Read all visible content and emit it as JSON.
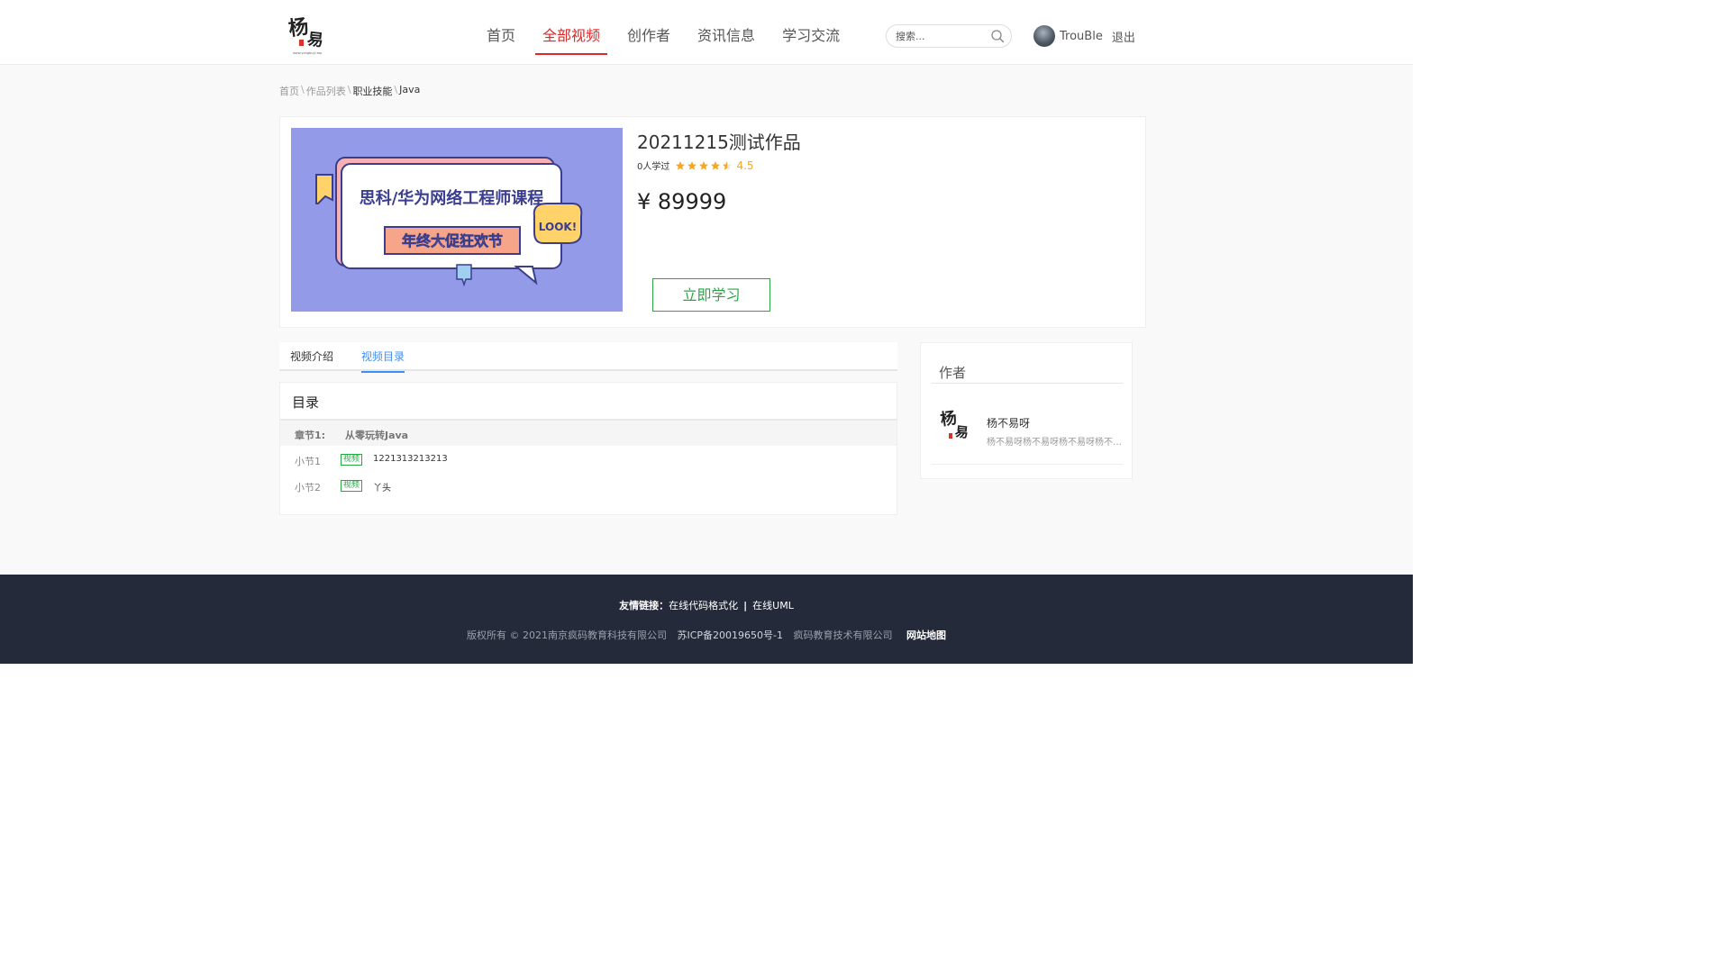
{
  "brand": {
    "logo_text": "杨不易",
    "logo_sub": "www.yangbuyi.top"
  },
  "nav": {
    "items": [
      {
        "label": "首页",
        "active": false
      },
      {
        "label": "全部视频",
        "active": true
      },
      {
        "label": "创作者",
        "active": false
      },
      {
        "label": "资讯信息",
        "active": false
      },
      {
        "label": "学习交流",
        "active": false
      }
    ],
    "active_color": "#e02626"
  },
  "search": {
    "placeholder": "搜索...",
    "value": ""
  },
  "user": {
    "name": "TrouBle",
    "logout_label": "退出"
  },
  "breadcrumb": {
    "items": [
      "首页",
      "作品列表",
      "职业技能",
      "Java"
    ],
    "separator": "\\"
  },
  "course": {
    "title": "20211215测试作品",
    "learners": "0人学过",
    "rating": "4.5",
    "rating_stars": 4.5,
    "price": "¥ 89999",
    "cta_label": "立即学习",
    "cover": {
      "headline": "思科/华为网络工程师课程",
      "subline": "年终大促狂欢节",
      "sticker": "LOOK!",
      "background": "#939ae8"
    }
  },
  "tabs": {
    "items": [
      {
        "label": "视频介绍",
        "active": false
      },
      {
        "label": "视频目录",
        "active": true
      }
    ],
    "active_color": "#3d8ff5"
  },
  "catalog": {
    "title": "目录",
    "chapter": {
      "label": "章节1:",
      "name": "从零玩转Java"
    },
    "sections": [
      {
        "label": "小节1",
        "badge": "视频",
        "name": "1221313213213"
      },
      {
        "label": "小节2",
        "badge": "视频",
        "name": "丫头"
      }
    ]
  },
  "author": {
    "heading": "作者",
    "name": "杨不易呀",
    "desc": "杨不易呀杨不易呀杨不易呀杨不易呀杨不易呀"
  },
  "footer": {
    "links_label": "友情链接：",
    "links": [
      "在线代码格式化",
      "在线UML"
    ],
    "link_separator": "|",
    "copyright": "版权所有 © 2021南京疯码教育科技有限公司",
    "icp": "苏ICP备20019650号-1",
    "company": "疯码教育技术有限公司",
    "sitemap": "网站地图"
  }
}
